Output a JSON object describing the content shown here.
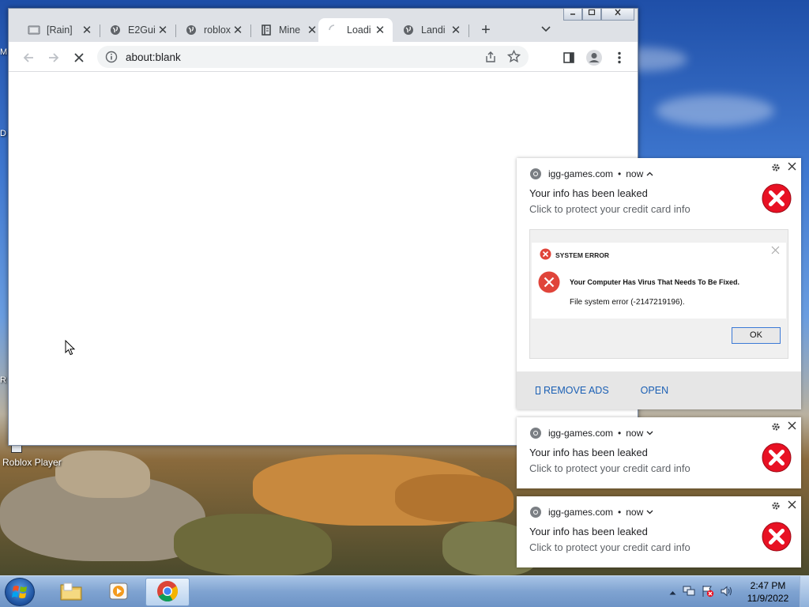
{
  "browser": {
    "tabs": [
      {
        "title": "[Rain]",
        "favicon": "page-icon"
      },
      {
        "title": "E2Gui",
        "favicon": "globe-icon"
      },
      {
        "title": "roblox",
        "favicon": "globe-icon"
      },
      {
        "title": "Mine",
        "favicon": "book-icon"
      },
      {
        "title": "Loadi",
        "favicon": "loading-spinner-icon",
        "active": true
      },
      {
        "title": "Landi",
        "favicon": "globe-icon"
      }
    ],
    "close_glyph": "✕",
    "new_tab_glyph": "+",
    "url": "about:blank"
  },
  "desktop": {
    "icons": [
      {
        "label": "Roblox Player"
      }
    ],
    "edge_letters": [
      "M",
      "D",
      "R"
    ]
  },
  "notifications": [
    {
      "source": "igg-games.com",
      "time": "now",
      "expanded": true,
      "title": "Your info has been leaked",
      "body": "Click to protect your credit card info",
      "image": {
        "dialog_title": "SYSTEM ERROR",
        "message": "Your Computer Has Virus That Needs To Be Fixed.",
        "error": "File system error (-2147219196).",
        "ok": "OK"
      },
      "actions": [
        "REMOVE ADS",
        "OPEN"
      ]
    },
    {
      "source": "igg-games.com",
      "time": "now",
      "expanded": false,
      "title": "Your info has been leaked",
      "body": "Click to protect your credit card info"
    },
    {
      "source": "igg-games.com",
      "time": "now",
      "expanded": false,
      "title": "Your info has been leaked",
      "body": "Click to protect your credit card info"
    }
  ],
  "taskbar": {
    "apps": [
      "file-explorer",
      "media-player",
      "chrome"
    ],
    "clock": {
      "time": "2:47 PM",
      "date": "11/9/2022"
    }
  },
  "colors": {
    "error_red": "#e81123",
    "link_blue": "#1a5fb4"
  }
}
